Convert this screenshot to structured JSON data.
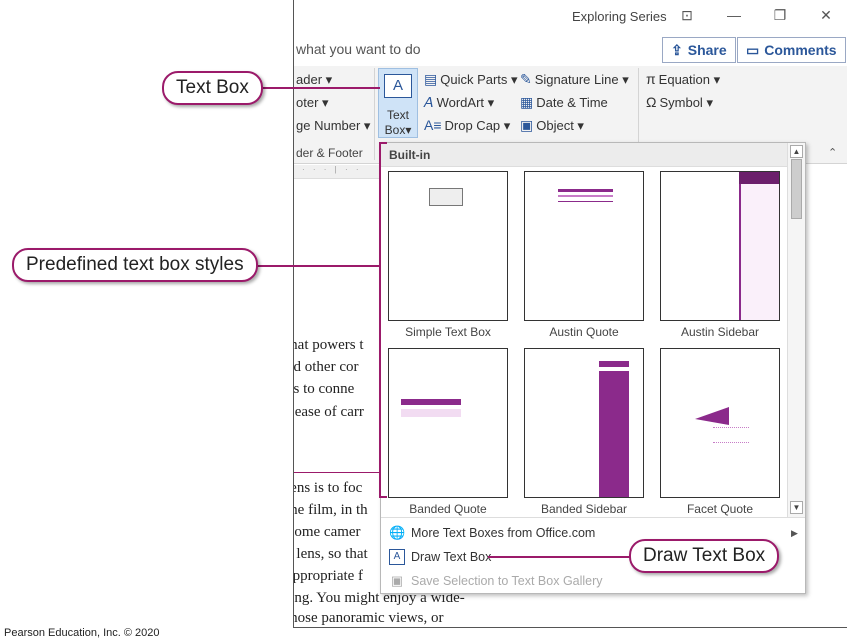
{
  "window": {
    "title": "Exploring Series",
    "controls": [
      "⊡",
      "—",
      "❐",
      "✕"
    ]
  },
  "tellme": "what you want to do",
  "share_label": "Share",
  "comments_label": "Comments",
  "ribbon": {
    "header_footer": [
      "ader",
      "oter",
      "ge Number"
    ],
    "group_header_footer": "der & Footer",
    "textbox_label_1": "Text",
    "textbox_label_2": "Box",
    "text_col1": [
      "Quick Parts",
      "WordArt",
      "Drop Cap"
    ],
    "text_col2": [
      "Signature Line",
      "Date & Time",
      "Object"
    ],
    "symbols": [
      "Equation",
      "Symbol"
    ]
  },
  "document_lines": [
    "that powers t",
    "nd other cor",
    "gs to conne",
    "r ease of carr",
    "lens is to foc",
    "the film, in th",
    "Some camer",
    "e lens, so that",
    "appropriate f",
    "ting. You might enjoy a wide-",
    "those panoramic views, or"
  ],
  "gallery": {
    "header": "Built-in",
    "items": [
      "Simple Text Box",
      "Austin Quote",
      "Austin Sidebar",
      "Banded Quote",
      "Banded Sidebar",
      "Facet Quote"
    ],
    "footer": [
      "More Text Boxes from Office.com",
      "Draw Text Box",
      "Save Selection to Text Box Gallery"
    ]
  },
  "callouts": {
    "text_box": "Text Box",
    "predefined": "Predefined text box styles",
    "draw": "Draw Text Box"
  },
  "copyright": "Pearson Education, Inc. © 2020",
  "colors": {
    "accent": "#9b1a6a",
    "brand_blue": "#2b579a",
    "thumb_purple": "#8b2a8b"
  }
}
